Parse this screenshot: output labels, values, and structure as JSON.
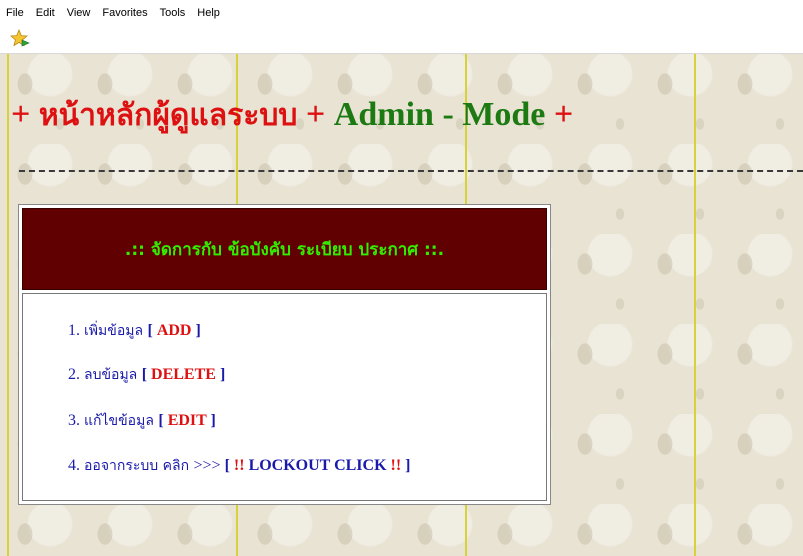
{
  "menubar": {
    "items": [
      "File",
      "Edit",
      "View",
      "Favorites",
      "Tools",
      "Help"
    ]
  },
  "page": {
    "title_prefix": "+ ",
    "title_thai": "หน้าหลักผู้ดูแลระบบ",
    "title_mid": " + ",
    "title_english": "Admin - Mode",
    "title_suffix": " +",
    "panel_heading": ".:: จัดการกับ ข้อบังคับ ระเบียบ ประกาศ ::.",
    "menu": [
      {
        "num": "1. ",
        "thai": "เพิ่มข้อมูล ",
        "open": "[ ",
        "cmd": "ADD",
        "close": " ]"
      },
      {
        "num": "2. ",
        "thai": "ลบข้อมูล ",
        "open": "[ ",
        "cmd": "DELETE",
        "close": " ]"
      },
      {
        "num": "3. ",
        "thai": "แก้ไขข้อมูล ",
        "open": "[ ",
        "cmd": "EDIT",
        "close": " ]"
      },
      {
        "num": "4. ",
        "thai": "ออจากระบบ คลิก ",
        "arrow": ">>> ",
        "open": "[ ",
        "cmd": "!! ",
        "cmd2": "LOCKOUT CLICK",
        "cmd3": " !!",
        "close": " ]"
      }
    ]
  },
  "colors": {
    "title_red": "#dd1111",
    "title_green": "#1d7a13",
    "panel_head_bg": "#600000",
    "panel_head_text": "#33ee00",
    "link_blue": "#1a1aaa"
  }
}
